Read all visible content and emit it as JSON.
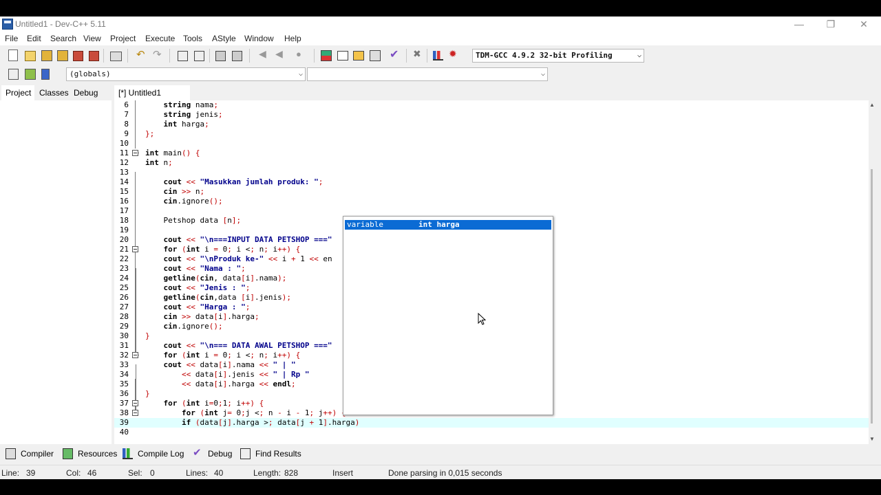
{
  "window": {
    "title": "Untitled1 - Dev-C++ 5.11",
    "minimize": "—",
    "maximize": "❐",
    "close": "✕"
  },
  "menu": [
    "File",
    "Edit",
    "Search",
    "View",
    "Project",
    "Execute",
    "Tools",
    "AStyle",
    "Window",
    "Help"
  ],
  "toolbar": {
    "compiler": "TDM-GCC 4.9.2 32-bit Profiling",
    "globals": "(globals)",
    "members": ""
  },
  "left_tabs": [
    "Project",
    "Classes",
    "Debug"
  ],
  "editor_tab": "[*] Untitled1",
  "code_lines": [
    {
      "n": "6",
      "t": "    string nama;"
    },
    {
      "n": "7",
      "t": "    string jenis;"
    },
    {
      "n": "8",
      "t": "    int harga;"
    },
    {
      "n": "9",
      "t": "};"
    },
    {
      "n": "10",
      "t": ""
    },
    {
      "n": "11",
      "t": "int main() {"
    },
    {
      "n": "12",
      "t": "int n;"
    },
    {
      "n": "13",
      "t": ""
    },
    {
      "n": "14",
      "t": "    cout << \"Masukkan jumlah produk: \";"
    },
    {
      "n": "15",
      "t": "    cin >> n;"
    },
    {
      "n": "16",
      "t": "    cin.ignore();"
    },
    {
      "n": "17",
      "t": ""
    },
    {
      "n": "18",
      "t": "    Petshop data [n];"
    },
    {
      "n": "19",
      "t": ""
    },
    {
      "n": "20",
      "t": "    cout << \"\\n===INPUT DATA PETSHOP ===\""
    },
    {
      "n": "21",
      "t": "    for (int i = 0; i < n; i++) {"
    },
    {
      "n": "22",
      "t": "    cout << \"\\nProduk ke-\" << i + 1 << en"
    },
    {
      "n": "23",
      "t": "    cout << \"Nama : \";"
    },
    {
      "n": "24",
      "t": "    getline(cin, data[i].nama);"
    },
    {
      "n": "25",
      "t": "    cout << \"Jenis : \";"
    },
    {
      "n": "26",
      "t": "    getline(cin,data [i].jenis);"
    },
    {
      "n": "27",
      "t": "    cout << \"Harga : \";"
    },
    {
      "n": "28",
      "t": "    cin >> data[i].harga;"
    },
    {
      "n": "29",
      "t": "    cin.ignore();"
    },
    {
      "n": "30",
      "t": "}"
    },
    {
      "n": "31",
      "t": "    cout << \"\\n=== DATA AWAL PETSHOP ===\""
    },
    {
      "n": "32",
      "t": "    for (int i = 0; i < n; i++) {"
    },
    {
      "n": "33",
      "t": "    cout << data[i].nama << \" | \""
    },
    {
      "n": "34",
      "t": "        << data[i].jenis << \" | Rp \""
    },
    {
      "n": "35",
      "t": "        << data[i].harga << endl;"
    },
    {
      "n": "36",
      "t": "}"
    },
    {
      "n": "37",
      "t": "    for (int i=0;1; i++) {"
    },
    {
      "n": "38",
      "t": "        for (int j= 0;j < n - i - 1; j++) {"
    },
    {
      "n": "39",
      "t": "        if (data[j].harga > data[j + 1].harga)"
    },
    {
      "n": "40",
      "t": ""
    }
  ],
  "autocomplete": {
    "kind": "variable",
    "signature": "int harga"
  },
  "bottom_tabs": [
    "Compiler",
    "Resources",
    "Compile Log",
    "Debug",
    "Find Results"
  ],
  "status": {
    "line_label": "Line:",
    "line": "39",
    "col_label": "Col:",
    "col": "46",
    "sel_label": "Sel:",
    "sel": "0",
    "lines_label": "Lines:",
    "lines": "40",
    "length_label": "Length:",
    "length": "828",
    "mode": "Insert",
    "message": "Done parsing in 0,015 seconds"
  },
  "colors": {
    "selection": "#0b6bd4",
    "current_line": "#e0ffff",
    "keyword_text": "#000000",
    "string_text": "#00008b",
    "bracket_highlight": "#ff0000"
  }
}
